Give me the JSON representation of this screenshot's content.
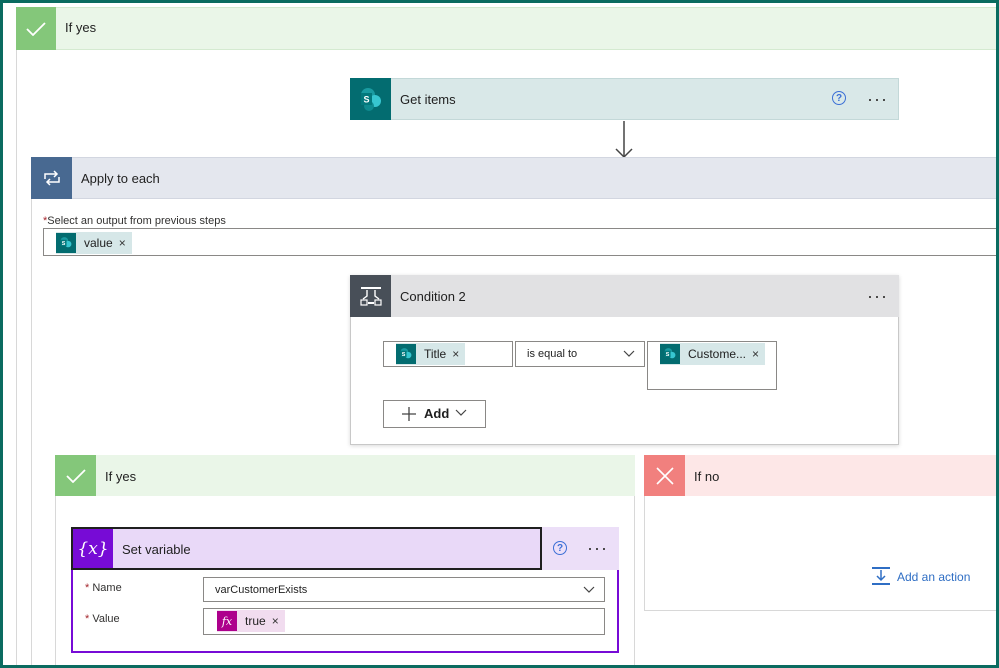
{
  "outer_if_yes": {
    "label": "If yes"
  },
  "get_items": {
    "label": "Get items"
  },
  "apply_to_each": {
    "label": "Apply to each",
    "output_label": "Select an output from previous steps",
    "required_mark": "*",
    "token": "value"
  },
  "condition": {
    "label": "Condition 2",
    "left_token": "Title",
    "operator": "is equal to",
    "right_token": "Custome...",
    "add_label": "Add"
  },
  "inner_if_yes": {
    "label": "If yes"
  },
  "inner_if_no": {
    "label": "If no",
    "add_action": "Add an action"
  },
  "set_variable": {
    "label": "Set variable",
    "icon_text": "{x}",
    "name_label": "Name",
    "name_value": "varCustomerExists",
    "value_label": "Value",
    "value_token": "true",
    "fx": "fx"
  },
  "token_close": "×",
  "colors": {
    "frame": "#0a6b60",
    "sharepoint": "#036c70",
    "yes_green": "#84c77a",
    "no_red": "#f1807e",
    "variable_purple": "#770bd6",
    "loop_blue": "#486991",
    "condition_gray": "#484f58"
  }
}
